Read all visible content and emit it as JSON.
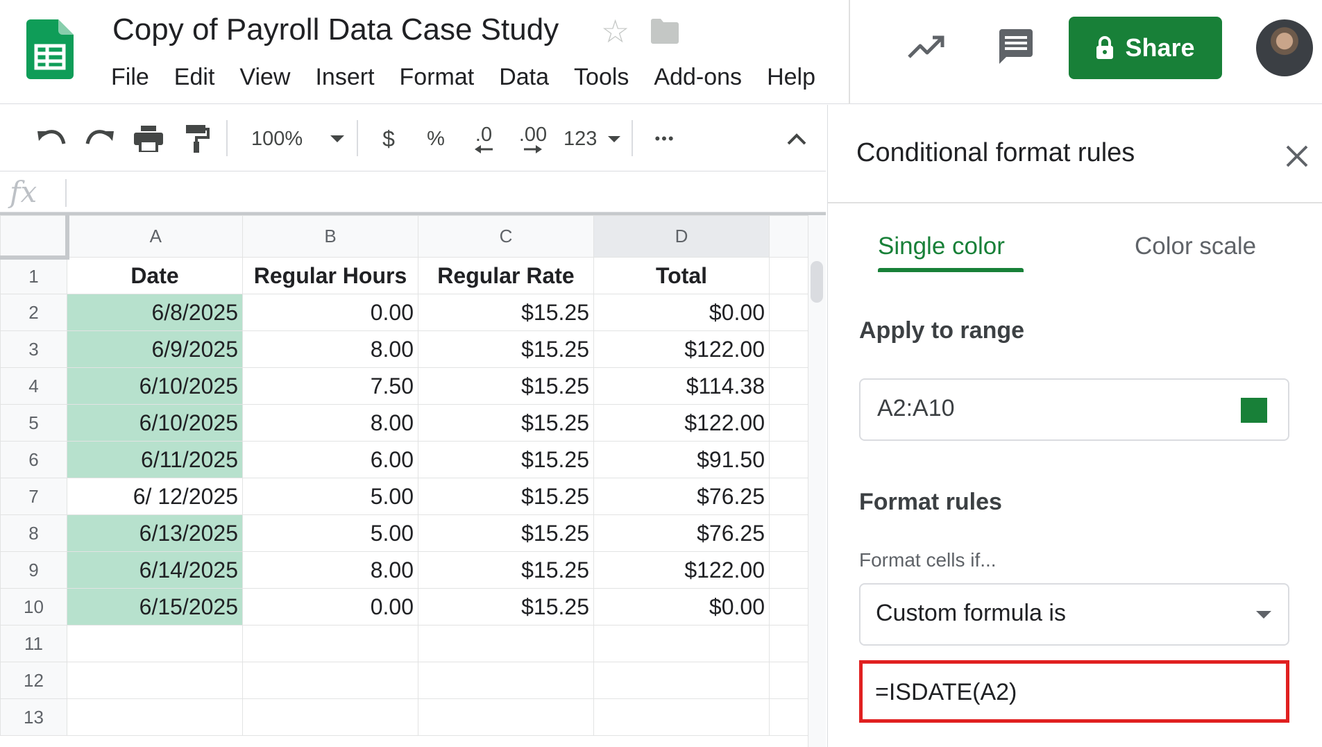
{
  "header": {
    "title": "Copy of Payroll Data Case Study",
    "menus": [
      "File",
      "Edit",
      "View",
      "Insert",
      "Format",
      "Data",
      "Tools",
      "Add-ons",
      "Help"
    ],
    "share_label": "Share"
  },
  "toolbar": {
    "zoom": "100%",
    "currency": "$",
    "percent": "%",
    "decrease_decimal": ".0",
    "increase_decimal": ".00",
    "number_format": "123",
    "more": "•••"
  },
  "formula_bar": {
    "icon": "fx",
    "value": ""
  },
  "sheet": {
    "columns": [
      "A",
      "B",
      "C",
      "D"
    ],
    "rows": [
      {
        "num": "1",
        "cells": [
          "Date",
          "Regular Hours",
          "Regular Rate",
          "Total"
        ]
      },
      {
        "num": "2",
        "cells": [
          "6/8/2025",
          "0.00",
          "$15.25",
          "$0.00"
        ]
      },
      {
        "num": "3",
        "cells": [
          "6/9/2025",
          "8.00",
          "$15.25",
          "$122.00"
        ]
      },
      {
        "num": "4",
        "cells": [
          "6/10/2025",
          "7.50",
          "$15.25",
          "$114.38"
        ]
      },
      {
        "num": "5",
        "cells": [
          "6/10/2025",
          "8.00",
          "$15.25",
          "$122.00"
        ]
      },
      {
        "num": "6",
        "cells": [
          "6/11/2025",
          "6.00",
          "$15.25",
          "$91.50"
        ]
      },
      {
        "num": "7",
        "cells": [
          "6/ 12/2025",
          "5.00",
          "$15.25",
          "$76.25"
        ]
      },
      {
        "num": "8",
        "cells": [
          "6/13/2025",
          "5.00",
          "$15.25",
          "$76.25"
        ]
      },
      {
        "num": "9",
        "cells": [
          "6/14/2025",
          "8.00",
          "$15.25",
          "$122.00"
        ]
      },
      {
        "num": "10",
        "cells": [
          "6/15/2025",
          "0.00",
          "$15.25",
          "$0.00"
        ]
      },
      {
        "num": "11",
        "cells": [
          "",
          "",
          "",
          ""
        ]
      },
      {
        "num": "12",
        "cells": [
          "",
          "",
          "",
          ""
        ]
      },
      {
        "num": "13",
        "cells": [
          "",
          "",
          "",
          ""
        ]
      }
    ],
    "highlight_color": "#b7e1cd"
  },
  "panel": {
    "title": "Conditional format rules",
    "tabs": [
      "Single color",
      "Color scale"
    ],
    "apply_label": "Apply to range",
    "range": "A2:A10",
    "rules_label": "Format rules",
    "cells_if_label": "Format cells if...",
    "condition": "Custom formula is",
    "formula": "=ISDATE(A2)"
  },
  "colors": {
    "brand_green": "#188038",
    "highlight_border": "#e02020"
  }
}
